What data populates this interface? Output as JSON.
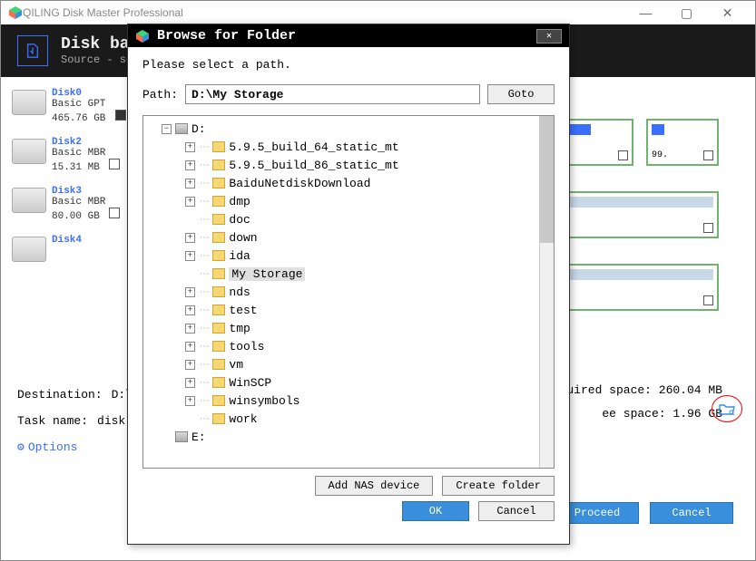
{
  "app": {
    "title": "QILING Disk Master Professional"
  },
  "header": {
    "title": "Disk back",
    "subtitle": "Source - se"
  },
  "disks": [
    {
      "name": "Disk0",
      "type": "Basic GPT",
      "size": "465.76 GB"
    },
    {
      "name": "Disk2",
      "type": "Basic MBR",
      "size": "15.31 MB"
    },
    {
      "name": "Disk3",
      "type": "Basic MBR",
      "size": "80.00 GB"
    },
    {
      "name": "Disk4",
      "type": "",
      "size": ""
    }
  ],
  "partitions": {
    "right1_val": "99."
  },
  "bottom": {
    "dest_label": "Destination:",
    "dest_value": "D:\\My",
    "task_label": "Task name:",
    "task_value": "disk",
    "options_label": "Options",
    "required_label": "uired space: 260.04 MB",
    "free_label": "ee space: 1.96 GB",
    "proceed": "Proceed",
    "cancel": "Cancel"
  },
  "dialog": {
    "title": "Browse for Folder",
    "prompt": "Please select a path.",
    "path_label": "Path:",
    "path_value": "D:\\My Storage",
    "goto": "Goto",
    "add_nas": "Add NAS device",
    "create_folder": "Create folder",
    "ok": "OK",
    "cancel": "Cancel",
    "tree": {
      "drive_d": "D:",
      "items": [
        "5.9.5_build_64_static_mt",
        "5.9.5_build_86_static_mt",
        "BaiduNetdiskDownload",
        "dmp",
        "doc",
        "down",
        "ida",
        "My Storage",
        "nds",
        "test",
        "tmp",
        "tools",
        "vm",
        "WinSCP",
        "winsymbols",
        "work"
      ],
      "drive_e": "E:"
    }
  }
}
